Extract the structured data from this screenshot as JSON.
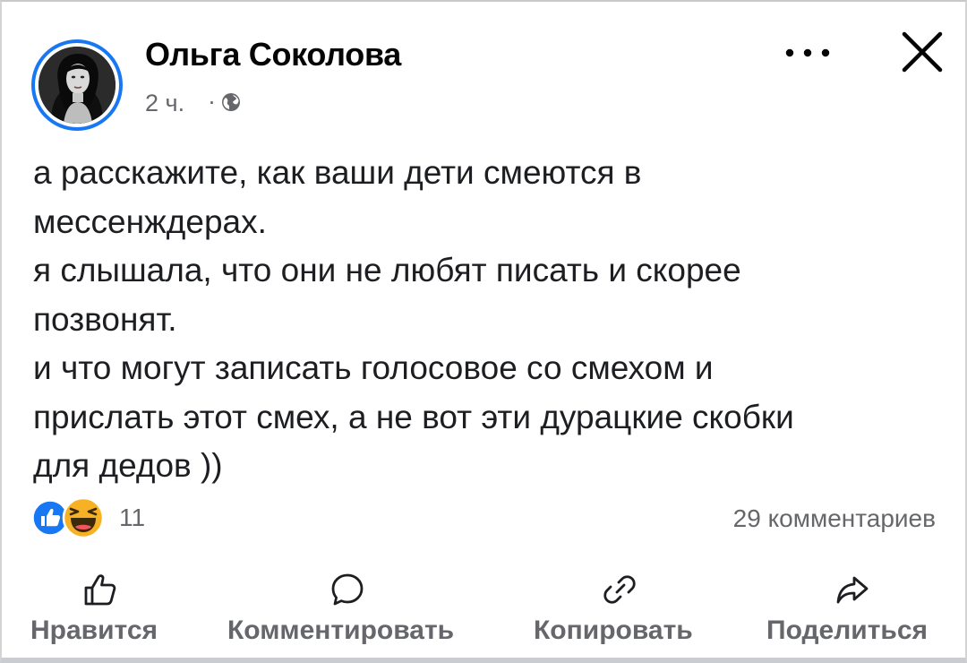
{
  "post": {
    "author": "Ольга Соколова",
    "time": "2 ч.",
    "separator": "·",
    "audience_icon": "globe-icon",
    "lines": [
      "а расскажите, как ваши дети смеются в",
      "мессенждерах.",
      "я слышала, что они не любят писать и скорее",
      "позвонят.",
      "и что могут записать голосовое со смехом и",
      "прислать этот смех, а не вот эти дурацкие скобки",
      "для дедов ))"
    ]
  },
  "header": {
    "more_icon": "more-dots-icon",
    "close_icon": "close-icon"
  },
  "stats": {
    "reactions": [
      "like",
      "haha"
    ],
    "reaction_count": "11",
    "comments": "29 комментариев"
  },
  "actions": {
    "like": "Нравится",
    "comment": "Комментировать",
    "copy": "Копировать",
    "share": "Поделиться"
  },
  "colors": {
    "accent": "#1877f2",
    "secondary_text": "#65676b",
    "haha": "#f7b125"
  }
}
